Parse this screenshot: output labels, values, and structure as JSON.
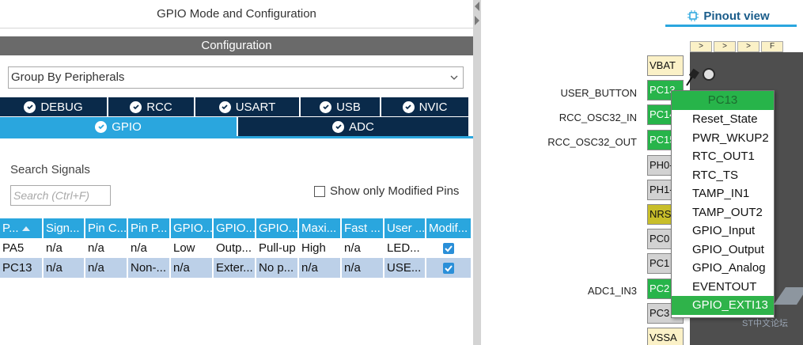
{
  "left_panel": {
    "title": "GPIO Mode and Configuration",
    "configuration_label": "Configuration",
    "group_select": "Group By Peripherals",
    "tabs_row1": [
      "DEBUG",
      "RCC",
      "USART",
      "USB",
      "NVIC"
    ],
    "tabs_row2": [
      "GPIO",
      "ADC"
    ],
    "active_tab": "GPIO",
    "search_label": "Search Signals",
    "search_placeholder": "Search (Ctrl+F)",
    "show_modified_label": "Show only Modified Pins",
    "table": {
      "columns": [
        "P...",
        "Sign...",
        "Pin C...",
        "Pin P...",
        "GPIO...",
        "GPIO...",
        "GPIO...",
        "Maxi...",
        "Fast ...",
        "User ...",
        "Modif..."
      ],
      "rows": [
        [
          "PA5",
          "n/a",
          "n/a",
          "n/a",
          "Low",
          "Outp...",
          "Pull-up",
          "High",
          "n/a",
          "LED...",
          true
        ],
        [
          "PC13",
          "n/a",
          "n/a",
          "Non-...",
          "n/a",
          "Exter...",
          "No p...",
          "n/a",
          "n/a",
          "USE...",
          true
        ]
      ]
    }
  },
  "right_panel": {
    "tab_label": "Pinout view",
    "top_pin_labels": [
      ">",
      ">",
      ">",
      "F"
    ],
    "pins": [
      {
        "name": "VBAT",
        "label": "",
        "color": "yellow"
      },
      {
        "name": "PC13",
        "label": "USER_BUTTON",
        "color": "green"
      },
      {
        "name": "PC14",
        "label": "RCC_OSC32_IN",
        "color": "green"
      },
      {
        "name": "PC15",
        "label": "RCC_OSC32_OUT",
        "color": "green"
      },
      {
        "name": "PH0-",
        "label": "",
        "color": "grey"
      },
      {
        "name": "PH1-",
        "label": "",
        "color": "grey"
      },
      {
        "name": "NRST",
        "label": "",
        "color": "olive"
      },
      {
        "name": "PC0",
        "label": "",
        "color": "grey"
      },
      {
        "name": "PC1",
        "label": "",
        "color": "grey"
      },
      {
        "name": "PC2",
        "label": "ADC1_IN3",
        "color": "green"
      },
      {
        "name": "PC3",
        "label": "",
        "color": "grey"
      },
      {
        "name": "VSSA",
        "label": "",
        "color": "yellow"
      }
    ],
    "context_menu": {
      "header": "PC13",
      "items": [
        "Reset_State",
        "PWR_WKUP2",
        "RTC_OUT1",
        "RTC_TS",
        "TAMP_IN1",
        "TAMP_OUT2",
        "GPIO_Input",
        "GPIO_Output",
        "GPIO_Analog",
        "EVENTOUT",
        "GPIO_EXTI13"
      ],
      "selected": "GPIO_EXTI13"
    },
    "watermark": "ST中文论坛"
  },
  "colors": {
    "tab_dark": "#0a2a4a",
    "tab_active": "#2aa6de",
    "pin_green": "#27b44a",
    "chip_body": "#4e4e4e"
  }
}
